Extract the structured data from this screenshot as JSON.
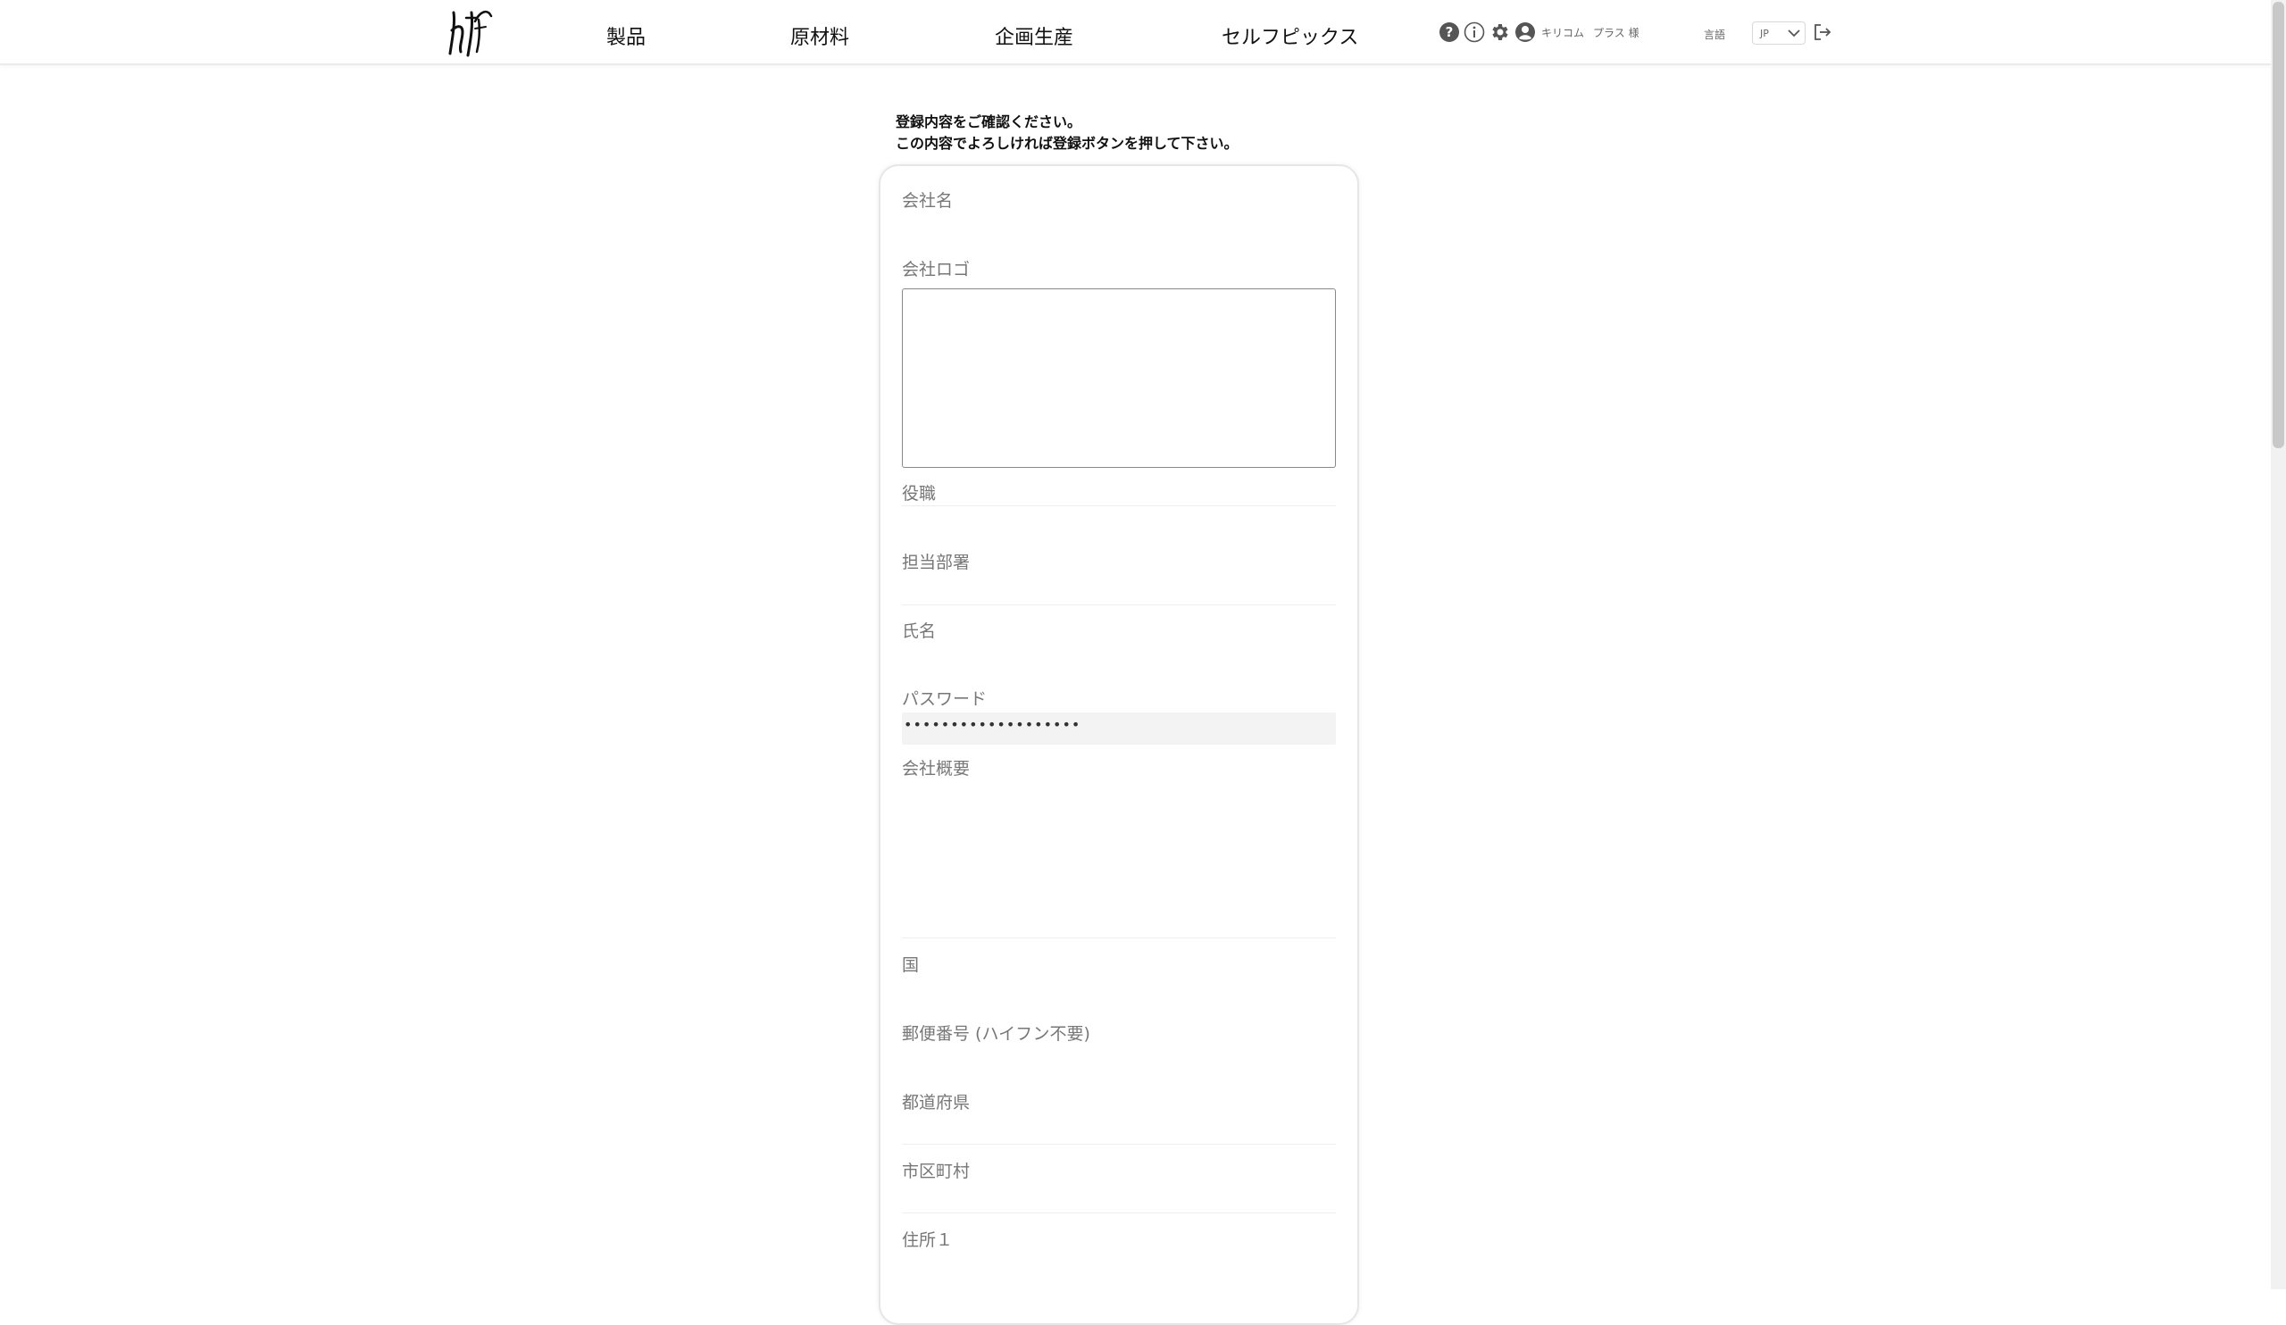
{
  "header": {
    "nav": [
      "製品",
      "原材料",
      "企画生産",
      "セルフピックス"
    ],
    "user_company": "キリコム",
    "user_name": "プラス 様",
    "language_label": "言語",
    "language_value": "JP"
  },
  "intro": {
    "line1": "登録内容をご確認ください。",
    "line2": "この内容でよろしければ登録ボタンを押して下さい。"
  },
  "form": {
    "company_name_label": "会社名",
    "company_logo_label": "会社ロゴ",
    "position_label": "役職",
    "department_label": "担当部署",
    "name_label": "氏名",
    "password_label": "パスワード",
    "password_value": "•••••••••••••••••••",
    "company_summary_label": "会社概要",
    "country_label": "国",
    "postal_code_label": "郵便番号 (ハイフン不要)",
    "prefecture_label": "都道府県",
    "city_label": "市区町村",
    "address1_label": "住所１"
  },
  "colors": {
    "text": "#111111",
    "label": "#777777",
    "border": "#e6e6e6"
  }
}
